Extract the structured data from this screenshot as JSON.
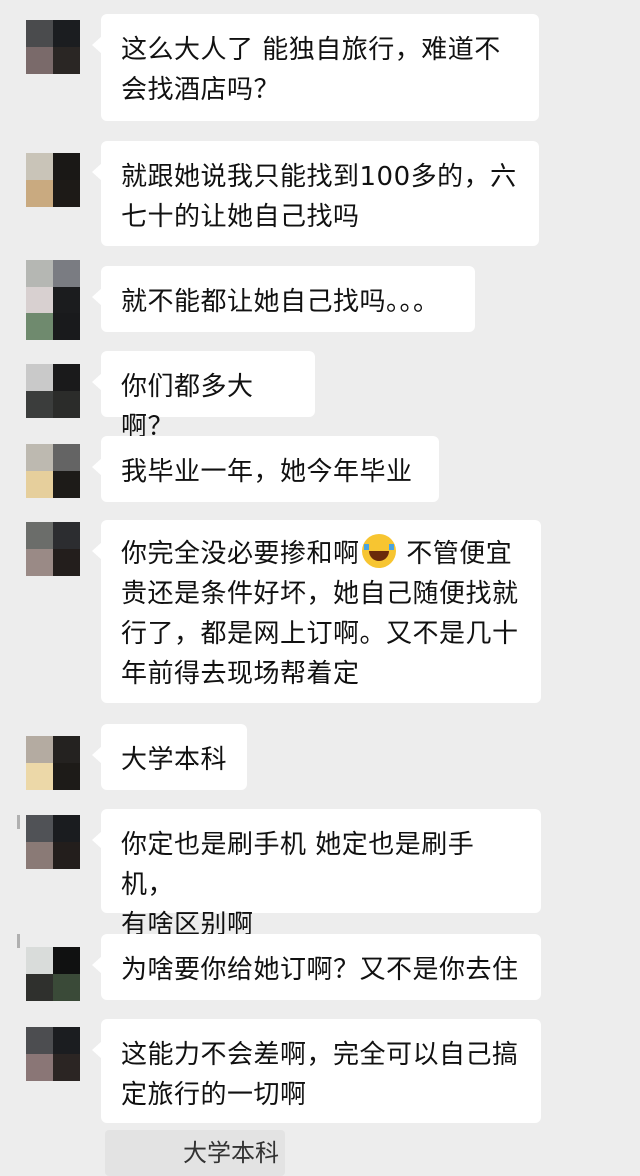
{
  "messages": [
    {
      "text": "这么大人了 能独自旅行，难道不\n会找酒店吗？",
      "avatar_colors": [
        "#4a4b4d",
        "#1b1d20",
        "#7a6a6a",
        "#2a2624"
      ]
    },
    {
      "text": "就跟她说我只能找到100多的，六\n七十的让她自己找吗",
      "avatar_colors": [
        "#c9c4b8",
        "#1a1816",
        "#c9aa80",
        "#1d1a17"
      ]
    },
    {
      "text": "就不能都让她自己找吗。。。",
      "avatar_colors": [
        "#b5b7b3",
        "#7a7c82",
        "#d8d0d0",
        "#1b1c1e",
        "#6f8a6e",
        "#191a1c"
      ]
    },
    {
      "text": "你们都多大啊？",
      "avatar_colors": [
        "#c9c9c9",
        "#1a1a1b",
        "#3b3d3c",
        "#2b2c2a"
      ]
    },
    {
      "text": "我毕业一年，她今年毕业",
      "avatar_colors": [
        "#bdb9b0",
        "#646464",
        "#e6cf9c",
        "#1d1b18"
      ]
    },
    {
      "text_before": "你完全没必要掺和啊",
      "emoji": "face-with-tears-of-joy-icon",
      "text_after": " 不管便宜\n贵还是条件好坏，她自己随便找就\n行了，都是网上订啊。又不是几十\n年前得去现场帮着定",
      "avatar_colors": [
        "#6b6d6a",
        "#2c2d30",
        "#9a8a86",
        "#231e1c"
      ]
    },
    {
      "text": "大学本科",
      "avatar_colors": [
        "#b4aba1",
        "#242220",
        "#ecd8a8",
        "#1d1b18"
      ]
    },
    {
      "text": "你定也是刷手机 她定也是刷手机，\n有啥区别啊",
      "avatar_colors": [
        "#505256",
        "#1a1c1f",
        "#8a7a76",
        "#231e1c"
      ]
    },
    {
      "text": "为啥要你给她订啊？又不是你去住",
      "avatar_colors": [
        "#d9dcda",
        "#101111",
        "#2f302d",
        "#3a4a38"
      ]
    },
    {
      "text": "这能力不会差啊，完全可以自己搞\n定旅行的一切啊",
      "avatar_colors": [
        "#4c4d50",
        "#1b1d20",
        "#8a7676",
        "#2b2523"
      ]
    }
  ],
  "quote": {
    "text": "大学本科"
  }
}
